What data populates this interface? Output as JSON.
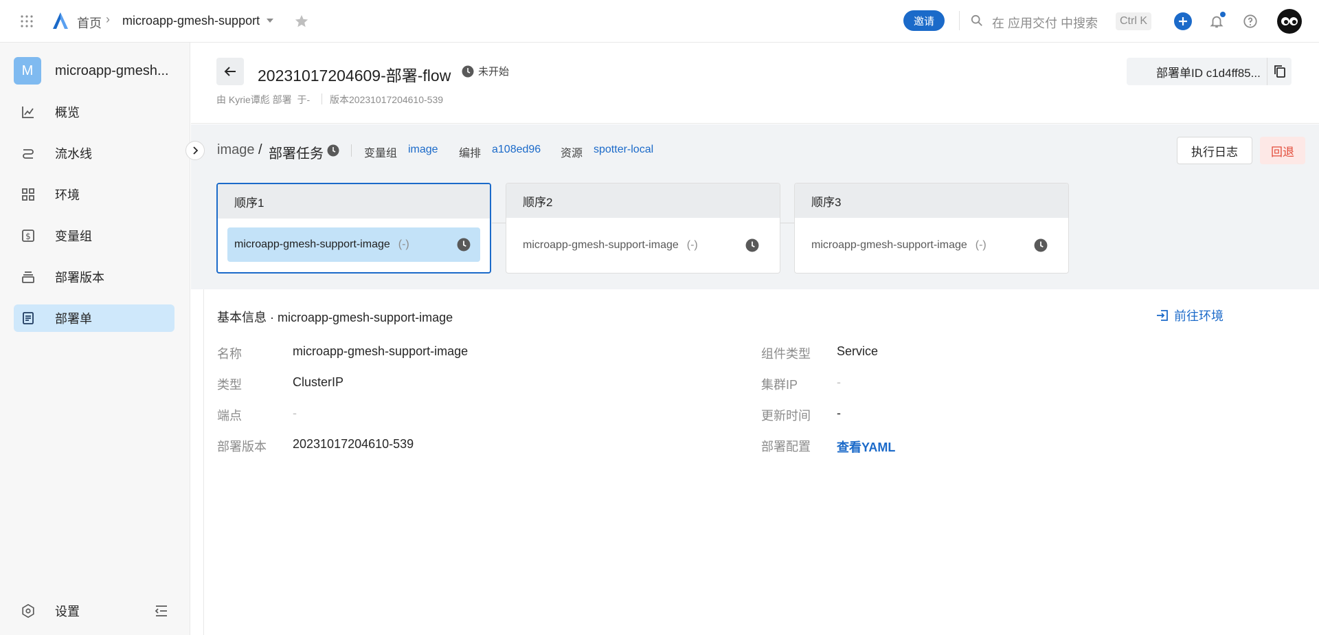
{
  "topbar": {
    "home": "首页",
    "project": "microapp-gmesh-support",
    "invite": "邀请",
    "search_placeholder": "在 应用交付 中搜索",
    "shortcut": "Ctrl K"
  },
  "sidebar": {
    "avatar_letter": "M",
    "app_name": "microapp-gmesh...",
    "items": [
      {
        "label": "概览",
        "icon": "line-chart-icon"
      },
      {
        "label": "流水线",
        "icon": "pipeline-icon"
      },
      {
        "label": "环境",
        "icon": "grid-icon"
      },
      {
        "label": "变量组",
        "icon": "dollar-icon"
      },
      {
        "label": "部署版本",
        "icon": "stack-icon"
      },
      {
        "label": "部署单",
        "icon": "document-icon"
      }
    ],
    "settings": "设置"
  },
  "header": {
    "title": "20231017204609-部署-flow",
    "status": "未开始",
    "meta_by": "由 Kyrie谭彪 部署  于-",
    "meta_version": "版本20231017204610-539",
    "order_id": "部署单ID c1d4ff85..."
  },
  "task_bar": {
    "crumb_image": "image",
    "crumb_sep": "/",
    "crumb_task": "部署任务",
    "vargroup_label": "变量组",
    "vargroup_value": "image",
    "orchestration_label": "编排",
    "orchestration_value": "a108ed96",
    "resource_label": "资源",
    "resource_value": "spotter-local",
    "log_button": "执行日志",
    "rollback_button": "回退"
  },
  "stages": [
    {
      "title": "顺序1",
      "task": "microapp-gmesh-support-image",
      "status": "(-)"
    },
    {
      "title": "顺序2",
      "task": "microapp-gmesh-support-image",
      "status": "(-)"
    },
    {
      "title": "顺序3",
      "task": "microapp-gmesh-support-image",
      "status": "(-)"
    }
  ],
  "info": {
    "title": "基本信息 · microapp-gmesh-support-image",
    "goto_env": "前往环境",
    "name_label": "名称",
    "name_value": "microapp-gmesh-support-image",
    "type_label": "类型",
    "type_value": "ClusterIP",
    "endpoint_label": "端点",
    "endpoint_value": "-",
    "version_label": "部署版本",
    "version_value": "20231017204610-539",
    "component_type_label": "组件类型",
    "component_type_value": "Service",
    "cluster_ip_label": "集群IP",
    "cluster_ip_value": "-",
    "update_time_label": "更新时间",
    "update_time_value": "-",
    "config_label": "部署配置",
    "config_value": "查看YAML"
  },
  "colors": {
    "accent": "#1b6ac9",
    "active_nav": "#cfe8fb",
    "rollback_bg": "#fde8e6",
    "rollback_text": "#e34d3b"
  }
}
